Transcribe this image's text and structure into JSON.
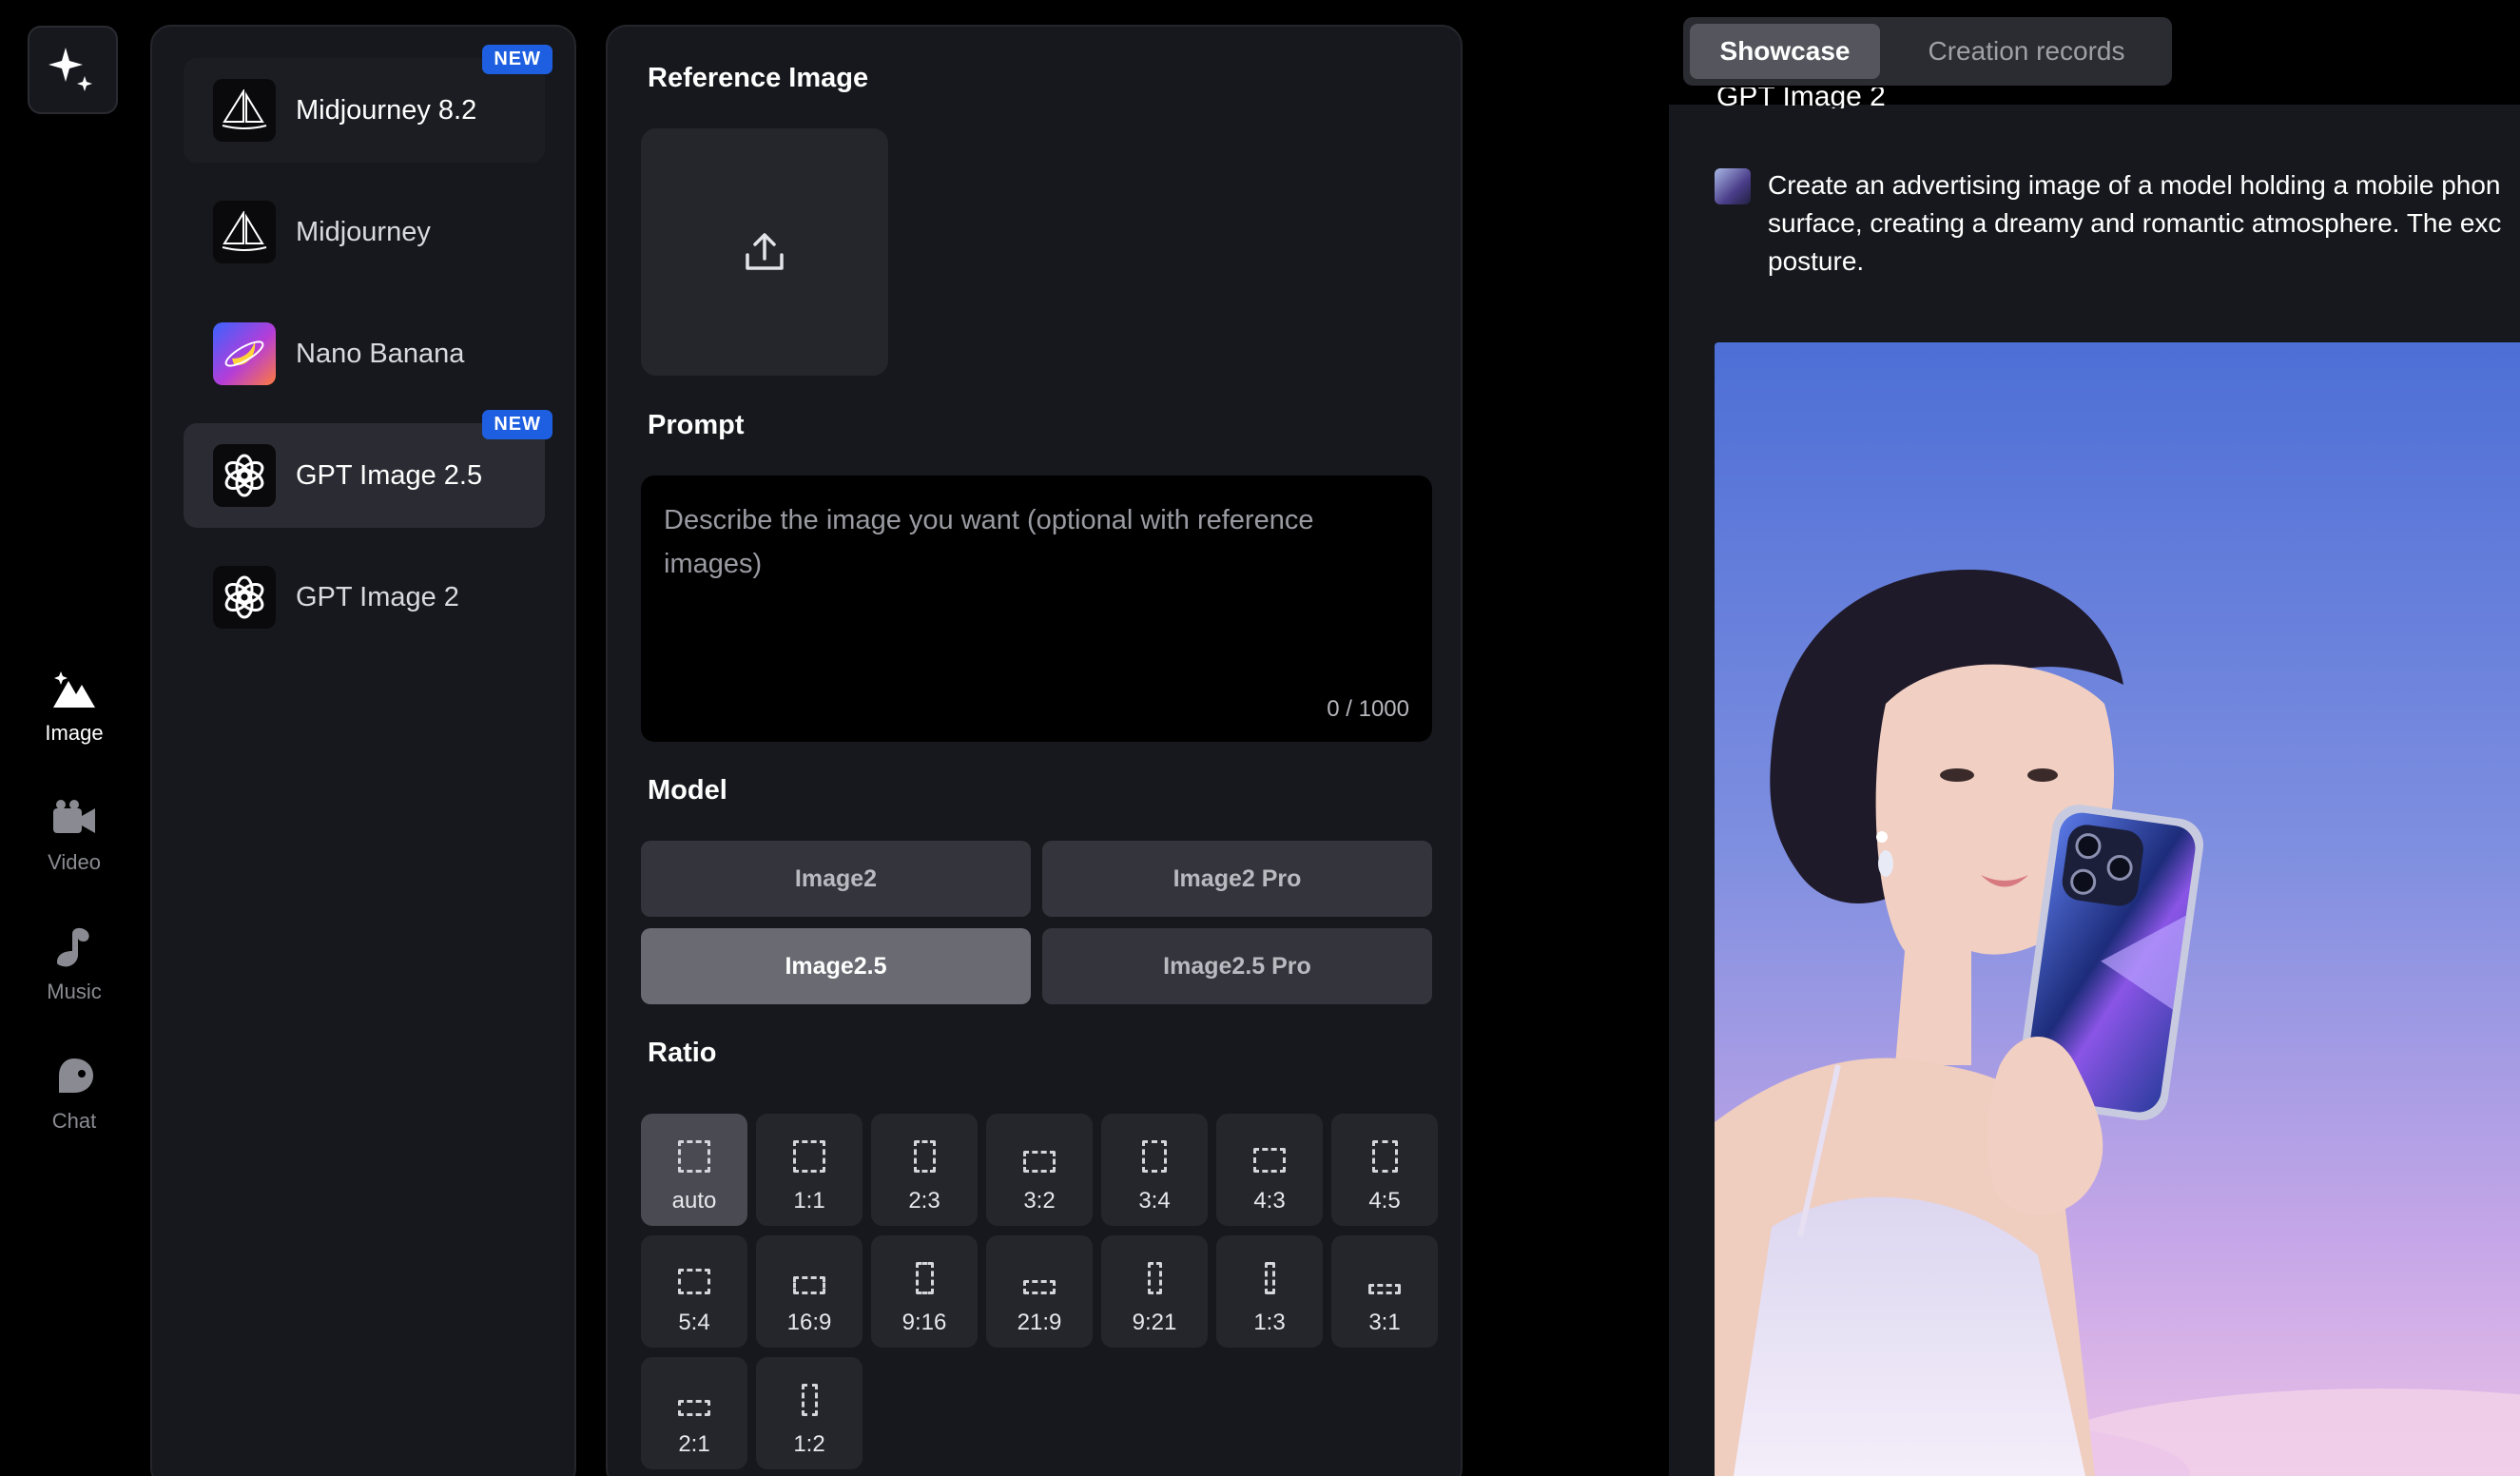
{
  "rail": {
    "items": [
      {
        "label": "Image",
        "icon": "image-icon",
        "active": true
      },
      {
        "label": "Video",
        "icon": "video-icon"
      },
      {
        "label": "Music",
        "icon": "music-icon"
      },
      {
        "label": "Chat",
        "icon": "chat-icon"
      }
    ]
  },
  "models": {
    "items": [
      {
        "label": "Midjourney 8.2",
        "badge": "NEW",
        "icon": "midjourney-icon"
      },
      {
        "label": "Midjourney",
        "icon": "midjourney-icon"
      },
      {
        "label": "Nano Banana",
        "icon": "nano-banana-icon"
      },
      {
        "label": "GPT Image 2.5",
        "badge": "NEW",
        "icon": "openai-icon",
        "selected": true
      },
      {
        "label": "GPT Image 2",
        "icon": "openai-icon"
      }
    ]
  },
  "form": {
    "reference_title": "Reference Image",
    "prompt_title": "Prompt",
    "prompt_placeholder": "Describe the image you want (optional with reference images)",
    "prompt_value": "",
    "prompt_count": "0 / 1000",
    "model_title": "Model",
    "model_options": [
      "Image2",
      "Image2 Pro",
      "Image2.5",
      "Image2.5 Pro"
    ],
    "model_selected": "Image2.5",
    "ratio_title": "Ratio",
    "ratios": [
      "auto",
      "1:1",
      "2:3",
      "3:2",
      "3:4",
      "4:3",
      "4:5",
      "5:4",
      "16:9",
      "9:16",
      "21:9",
      "9:21",
      "1:3",
      "3:1",
      "2:1",
      "1:2"
    ],
    "ratio_selected": "auto"
  },
  "showcase": {
    "tabs": [
      "Showcase",
      "Creation records"
    ],
    "active_tab": "Showcase",
    "model_line": "GPT Image 2",
    "prompt_lines": [
      "Create an advertising image of a model holding a mobile phon",
      "surface, creating a dreamy and romantic atmosphere. The exc",
      "posture."
    ]
  },
  "colors": {
    "background": "#000000",
    "panel": "#17181d",
    "badge": "#1d5fe0",
    "selected_model_button": "#6a6b72"
  }
}
